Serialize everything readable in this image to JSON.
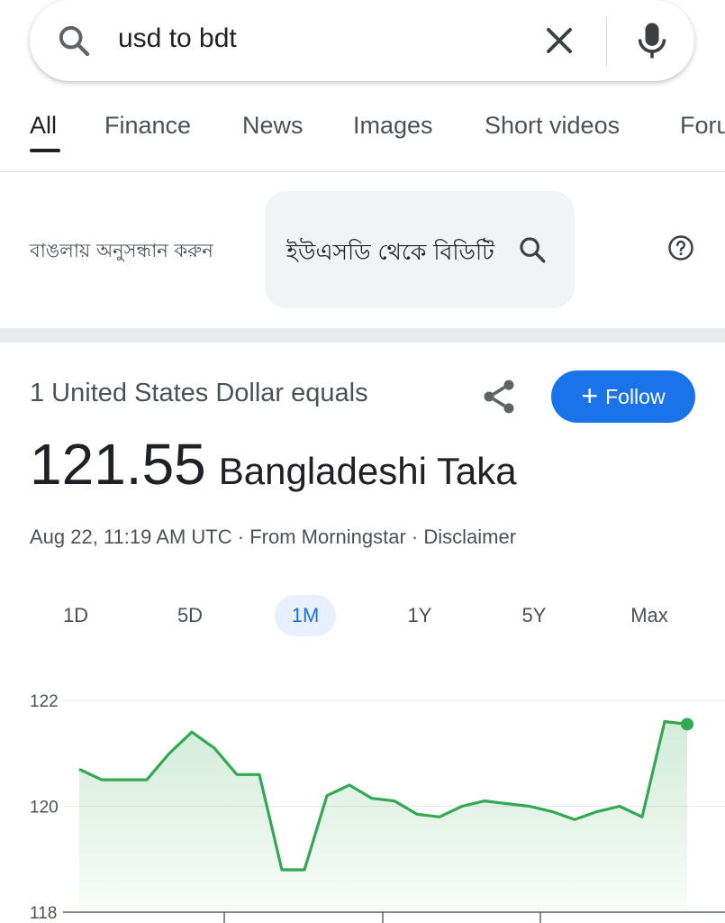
{
  "search": {
    "query": "usd to bdt"
  },
  "tabs": [
    {
      "label": "All",
      "active": true
    },
    {
      "label": "Finance",
      "active": false
    },
    {
      "label": "News",
      "active": false
    },
    {
      "label": "Images",
      "active": false
    },
    {
      "label": "Short videos",
      "active": false
    },
    {
      "label": "Foru",
      "active": false
    }
  ],
  "bengali": {
    "label": "বাঙলায় অনুসন্ধান করুন",
    "query": "ইউএসডি থেকে বিডিটি"
  },
  "converter": {
    "equals_text": "1 United States Dollar equals",
    "follow_label": "Follow",
    "rate": "121.55",
    "currency": "Bangladeshi Taka",
    "timestamp": "Aug 22, 11:19 AM UTC",
    "separator": "·",
    "source": "From Morningstar",
    "disclaimer": "Disclaimer"
  },
  "ranges": [
    {
      "label": "1D",
      "active": false
    },
    {
      "label": "5D",
      "active": false
    },
    {
      "label": "1M",
      "active": true
    },
    {
      "label": "1Y",
      "active": false
    },
    {
      "label": "5Y",
      "active": false
    },
    {
      "label": "Max",
      "active": false
    }
  ],
  "colors": {
    "accent": "#1a73e8",
    "line": "#34a853"
  },
  "chart_data": {
    "type": "area",
    "y_ticks": [
      "122",
      "120",
      "118"
    ],
    "ylim": [
      118,
      122
    ],
    "values": [
      120.7,
      120.5,
      120.5,
      120.5,
      121.0,
      121.4,
      121.1,
      120.6,
      120.6,
      118.8,
      118.8,
      120.2,
      120.4,
      120.15,
      120.1,
      119.85,
      119.8,
      120.0,
      120.1,
      120.05,
      120.0,
      119.9,
      119.75,
      119.9,
      120.0,
      119.8,
      121.6,
      121.55
    ],
    "grid": true,
    "last_point_marker": true
  }
}
